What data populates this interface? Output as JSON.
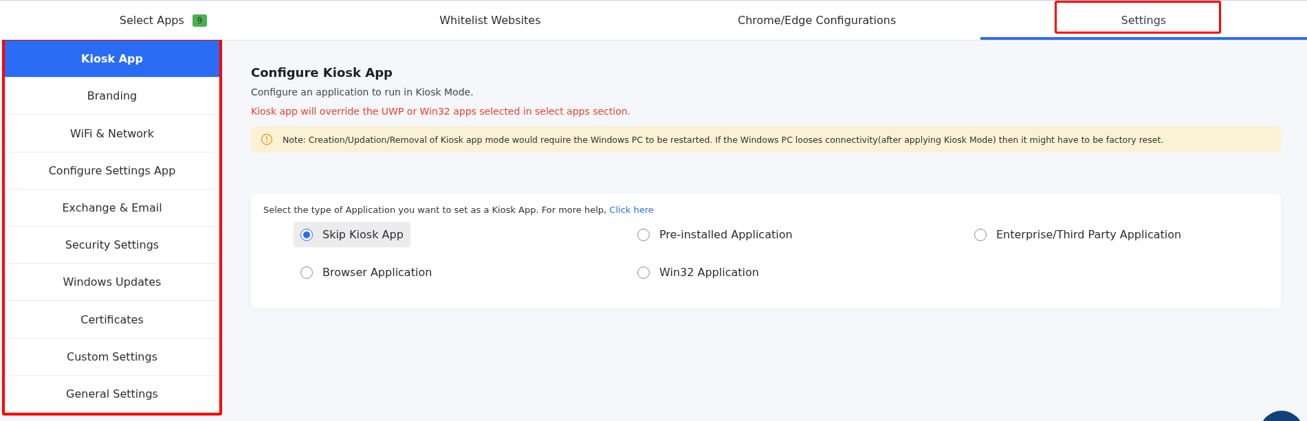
{
  "tabs": [
    {
      "label": "Select Apps",
      "badge": "9",
      "selected": false
    },
    {
      "label": "Whitelist Websites",
      "selected": false
    },
    {
      "label": "Chrome/Edge Configurations",
      "selected": false
    },
    {
      "label": "Settings",
      "selected": true
    }
  ],
  "sidebar": {
    "items": [
      {
        "label": "Kiosk App",
        "selected": true
      },
      {
        "label": "Branding",
        "selected": false
      },
      {
        "label": "WiFi & Network",
        "selected": false
      },
      {
        "label": "Configure Settings App",
        "selected": false
      },
      {
        "label": "Exchange & Email",
        "selected": false
      },
      {
        "label": "Security Settings",
        "selected": false
      },
      {
        "label": "Windows Updates",
        "selected": false
      },
      {
        "label": "Certificates",
        "selected": false
      },
      {
        "label": "Custom Settings",
        "selected": false
      },
      {
        "label": "General Settings",
        "selected": false
      }
    ]
  },
  "content": {
    "title": "Configure Kiosk App",
    "description": "Configure an application to run in Kiosk Mode.",
    "warning": "Kiosk app will override the UWP or Win32 apps selected in select apps section.",
    "note": "Note: Creation/Updation/Removal of Kiosk app mode would require the Windows PC to be restarted. If the Windows PC looses connectivity(after applying Kiosk Mode) then it might have to be factory reset."
  },
  "app_type": {
    "prompt": "Select the type of Application you want to set as a Kiosk App. For more help, ",
    "link": "Click here",
    "options": [
      {
        "label": "Skip Kiosk App",
        "selected": true
      },
      {
        "label": "Pre-installed Application",
        "selected": false
      },
      {
        "label": "Enterprise/Third Party Application",
        "selected": false
      },
      {
        "label": "Browser Application",
        "selected": false
      },
      {
        "label": "Win32 Application",
        "selected": false
      }
    ]
  }
}
